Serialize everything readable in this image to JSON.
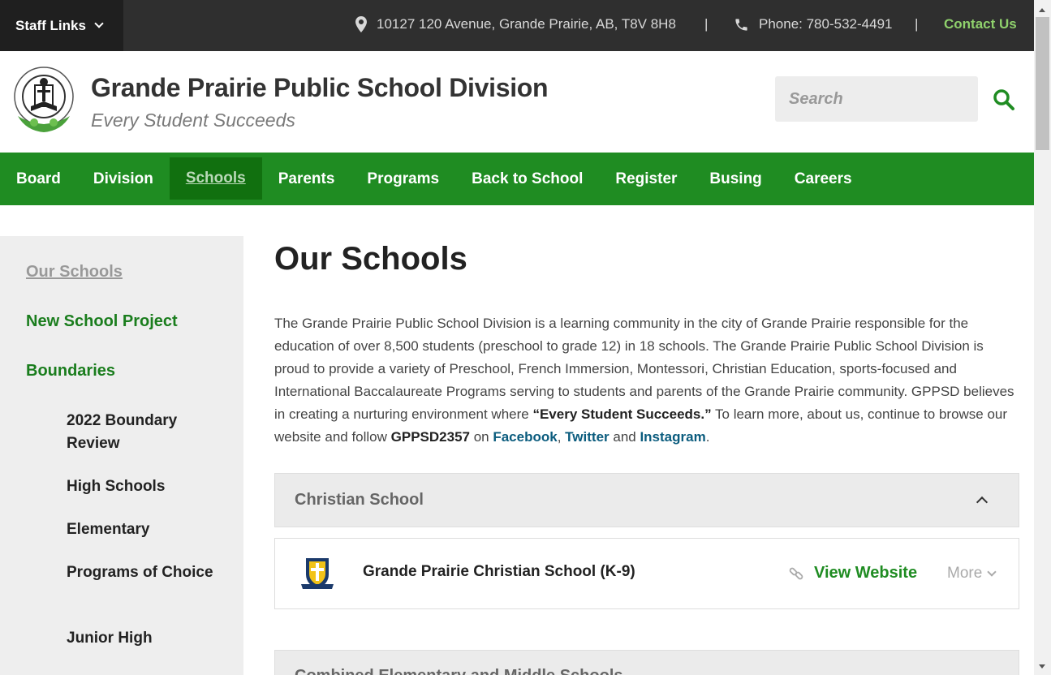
{
  "topbar": {
    "staff_links": "Staff Links",
    "address": "10127 120 Avenue, Grande Prairie, AB, T8V 8H8",
    "separator": "|",
    "phone": "Phone: 780-532-4491",
    "contact": "Contact Us"
  },
  "header": {
    "title": "Grande Prairie Public School Division",
    "tagline": "Every Student Succeeds",
    "search_placeholder": "Search"
  },
  "nav": {
    "items": [
      "Board",
      "Division",
      "Schools",
      "Parents",
      "Programs",
      "Back to School",
      "Register",
      "Busing",
      "Careers"
    ],
    "active": "Schools"
  },
  "sidebar": {
    "our_schools": "Our Schools",
    "new_school_project": "New School Project",
    "boundaries": "Boundaries",
    "sub": [
      "2022 Boundary Review",
      "High Schools",
      "Elementary",
      "Programs of Choice",
      "Junior High"
    ]
  },
  "main": {
    "title": "Our Schools",
    "intro_1": "The Grande Prairie Public School Division is a learning community in the city of Grande Prairie responsible for the education of over 8,500 students (preschool to grade 12) in 18 schools. The Grande Prairie Public School Division is proud to provide a variety of Preschool, French Immersion, Montessori, Christian Education, sports-focused and International Baccalaureate Programs serving to students and parents of the Grande Prairie community. GPPSD believes in creating a nurturing environment where ",
    "intro_bold": "“Every Student Succeeds.”",
    "intro_2": " To learn more, about us, continue to browse our website and follow ",
    "intro_handle": "GPPSD2357",
    "intro_on": " on ",
    "facebook": "Facebook",
    "comma": ",",
    "twitter": "Twitter",
    "and": " and ",
    "instagram": "Instagram",
    "period": ".",
    "accordion_1": "Christian School",
    "school_name": "Grande Prairie Christian School (K-9)",
    "view_website": "View Website",
    "more": "More",
    "accordion_2": "Combined Elementary and Middle Schools"
  },
  "colors": {
    "nav_green": "#1f8c22",
    "contact_green": "#8fd16c",
    "link_blue": "#0b5c7e"
  }
}
